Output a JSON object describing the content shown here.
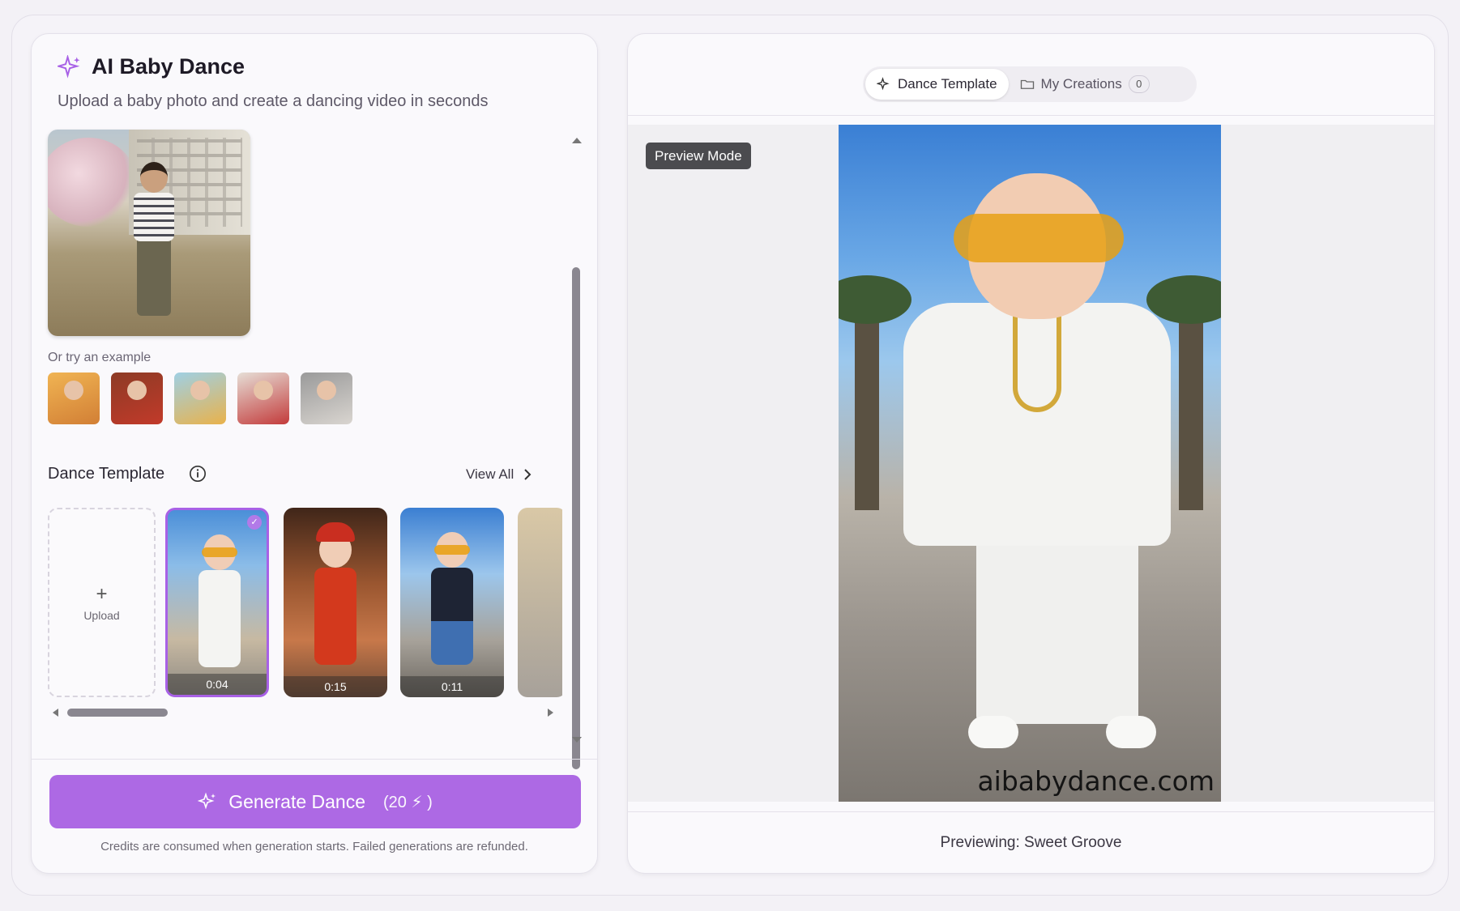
{
  "app": {
    "title": "AI Baby Dance",
    "subtitle": "Upload a baby photo and create a dancing video in seconds"
  },
  "examples": {
    "label": "Or try an example",
    "count": 5
  },
  "dance_template": {
    "title": "Dance Template",
    "view_all": "View All",
    "upload_label": "Upload",
    "templates": [
      {
        "duration": "0:04",
        "selected": true
      },
      {
        "duration": "0:15",
        "selected": false
      },
      {
        "duration": "0:11",
        "selected": false
      }
    ]
  },
  "generate": {
    "label": "Generate Dance",
    "cost": "(20 ⚡ )",
    "note": "Credits are consumed when generation starts. Failed generations are refunded."
  },
  "tabs": {
    "dance_template": "Dance Template",
    "my_creations": "My Creations",
    "creations_count": "0"
  },
  "preview": {
    "badge": "Preview Mode",
    "watermark": "aibabydance.com",
    "caption": "Previewing: Sweet Groove"
  },
  "colors": {
    "accent": "#ad69e4",
    "selected_border": "#a861e6"
  }
}
